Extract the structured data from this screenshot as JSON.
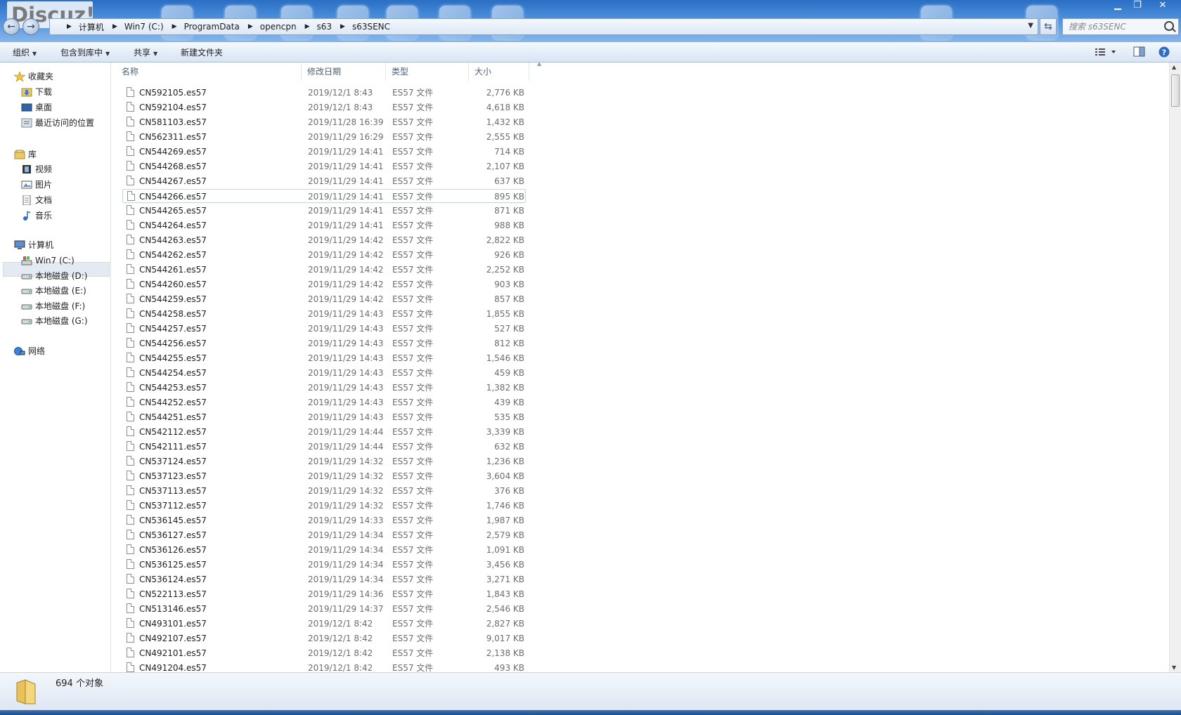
{
  "watermark": "Discuz!",
  "window": {
    "minimize": "▁",
    "restore": "❐",
    "close": "✕"
  },
  "address": {
    "crumbs": [
      "计算机",
      "Win7 (C:)",
      "ProgramData",
      "opencpn",
      "s63",
      "s63SENC"
    ],
    "separator": "▶"
  },
  "search": {
    "placeholder": "搜索 s63SENC"
  },
  "toolbar": {
    "organize": "组织",
    "include_library": "包含到库中",
    "share": "共享",
    "new_folder": "新建文件夹"
  },
  "nav": {
    "favorites": "收藏夹",
    "downloads": "下载",
    "desktop": "桌面",
    "recent": "最近访问的位置",
    "libraries": "库",
    "videos": "视频",
    "pictures": "图片",
    "documents": "文档",
    "music": "音乐",
    "computer": "计算机",
    "drive_c": "Win7 (C:)",
    "drive_d": "本地磁盘 (D:)",
    "drive_e": "本地磁盘 (E:)",
    "drive_f": "本地磁盘 (F:)",
    "drive_g": "本地磁盘 (G:)",
    "network": "网络"
  },
  "columns": {
    "name": "名称",
    "date": "修改日期",
    "type": "类型",
    "size": "大小"
  },
  "files": [
    {
      "name": "CN592105.es57",
      "date": "2019/12/1 8:43",
      "type": "ES57 文件",
      "size": "2,776 KB"
    },
    {
      "name": "CN592104.es57",
      "date": "2019/12/1 8:43",
      "type": "ES57 文件",
      "size": "4,618 KB"
    },
    {
      "name": "CN581103.es57",
      "date": "2019/11/28 16:39",
      "type": "ES57 文件",
      "size": "1,432 KB"
    },
    {
      "name": "CN562311.es57",
      "date": "2019/11/29 16:29",
      "type": "ES57 文件",
      "size": "2,555 KB"
    },
    {
      "name": "CN544269.es57",
      "date": "2019/11/29 14:41",
      "type": "ES57 文件",
      "size": "714 KB"
    },
    {
      "name": "CN544268.es57",
      "date": "2019/11/29 14:41",
      "type": "ES57 文件",
      "size": "2,107 KB"
    },
    {
      "name": "CN544267.es57",
      "date": "2019/11/29 14:41",
      "type": "ES57 文件",
      "size": "637 KB"
    },
    {
      "name": "CN544266.es57",
      "date": "2019/11/29 14:41",
      "type": "ES57 文件",
      "size": "895 KB"
    },
    {
      "name": "CN544265.es57",
      "date": "2019/11/29 14:41",
      "type": "ES57 文件",
      "size": "871 KB"
    },
    {
      "name": "CN544264.es57",
      "date": "2019/11/29 14:41",
      "type": "ES57 文件",
      "size": "988 KB"
    },
    {
      "name": "CN544263.es57",
      "date": "2019/11/29 14:42",
      "type": "ES57 文件",
      "size": "2,822 KB"
    },
    {
      "name": "CN544262.es57",
      "date": "2019/11/29 14:42",
      "type": "ES57 文件",
      "size": "926 KB"
    },
    {
      "name": "CN544261.es57",
      "date": "2019/11/29 14:42",
      "type": "ES57 文件",
      "size": "2,252 KB"
    },
    {
      "name": "CN544260.es57",
      "date": "2019/11/29 14:42",
      "type": "ES57 文件",
      "size": "903 KB"
    },
    {
      "name": "CN544259.es57",
      "date": "2019/11/29 14:42",
      "type": "ES57 文件",
      "size": "857 KB"
    },
    {
      "name": "CN544258.es57",
      "date": "2019/11/29 14:43",
      "type": "ES57 文件",
      "size": "1,855 KB"
    },
    {
      "name": "CN544257.es57",
      "date": "2019/11/29 14:43",
      "type": "ES57 文件",
      "size": "527 KB"
    },
    {
      "name": "CN544256.es57",
      "date": "2019/11/29 14:43",
      "type": "ES57 文件",
      "size": "812 KB"
    },
    {
      "name": "CN544255.es57",
      "date": "2019/11/29 14:43",
      "type": "ES57 文件",
      "size": "1,546 KB"
    },
    {
      "name": "CN544254.es57",
      "date": "2019/11/29 14:43",
      "type": "ES57 文件",
      "size": "459 KB"
    },
    {
      "name": "CN544253.es57",
      "date": "2019/11/29 14:43",
      "type": "ES57 文件",
      "size": "1,382 KB"
    },
    {
      "name": "CN544252.es57",
      "date": "2019/11/29 14:43",
      "type": "ES57 文件",
      "size": "439 KB"
    },
    {
      "name": "CN544251.es57",
      "date": "2019/11/29 14:43",
      "type": "ES57 文件",
      "size": "535 KB"
    },
    {
      "name": "CN542112.es57",
      "date": "2019/11/29 14:44",
      "type": "ES57 文件",
      "size": "3,339 KB"
    },
    {
      "name": "CN542111.es57",
      "date": "2019/11/29 14:44",
      "type": "ES57 文件",
      "size": "632 KB"
    },
    {
      "name": "CN537124.es57",
      "date": "2019/11/29 14:32",
      "type": "ES57 文件",
      "size": "1,236 KB"
    },
    {
      "name": "CN537123.es57",
      "date": "2019/11/29 14:32",
      "type": "ES57 文件",
      "size": "3,604 KB"
    },
    {
      "name": "CN537113.es57",
      "date": "2019/11/29 14:32",
      "type": "ES57 文件",
      "size": "376 KB"
    },
    {
      "name": "CN537112.es57",
      "date": "2019/11/29 14:32",
      "type": "ES57 文件",
      "size": "1,746 KB"
    },
    {
      "name": "CN536145.es57",
      "date": "2019/11/29 14:33",
      "type": "ES57 文件",
      "size": "1,987 KB"
    },
    {
      "name": "CN536127.es57",
      "date": "2019/11/29 14:34",
      "type": "ES57 文件",
      "size": "2,579 KB"
    },
    {
      "name": "CN536126.es57",
      "date": "2019/11/29 14:34",
      "type": "ES57 文件",
      "size": "1,091 KB"
    },
    {
      "name": "CN536125.es57",
      "date": "2019/11/29 14:34",
      "type": "ES57 文件",
      "size": "3,456 KB"
    },
    {
      "name": "CN536124.es57",
      "date": "2019/11/29 14:34",
      "type": "ES57 文件",
      "size": "3,271 KB"
    },
    {
      "name": "CN522113.es57",
      "date": "2019/11/29 14:36",
      "type": "ES57 文件",
      "size": "1,843 KB"
    },
    {
      "name": "CN513146.es57",
      "date": "2019/11/29 14:37",
      "type": "ES57 文件",
      "size": "2,546 KB"
    },
    {
      "name": "CN493101.es57",
      "date": "2019/12/1 8:42",
      "type": "ES57 文件",
      "size": "2,827 KB"
    },
    {
      "name": "CN492107.es57",
      "date": "2019/12/1 8:42",
      "type": "ES57 文件",
      "size": "9,017 KB"
    },
    {
      "name": "CN492101.es57",
      "date": "2019/12/1 8:42",
      "type": "ES57 文件",
      "size": "2,138 KB"
    },
    {
      "name": "CN491204.es57",
      "date": "2019/12/1 8:42",
      "type": "ES57 文件",
      "size": "493 KB"
    }
  ],
  "hover_index": 7,
  "status": {
    "count": "694 个对象"
  },
  "colors": {
    "title_blue": "#2a6fc4",
    "toolbar": "#e4edf8",
    "hover_border": "#c4d4e8"
  }
}
